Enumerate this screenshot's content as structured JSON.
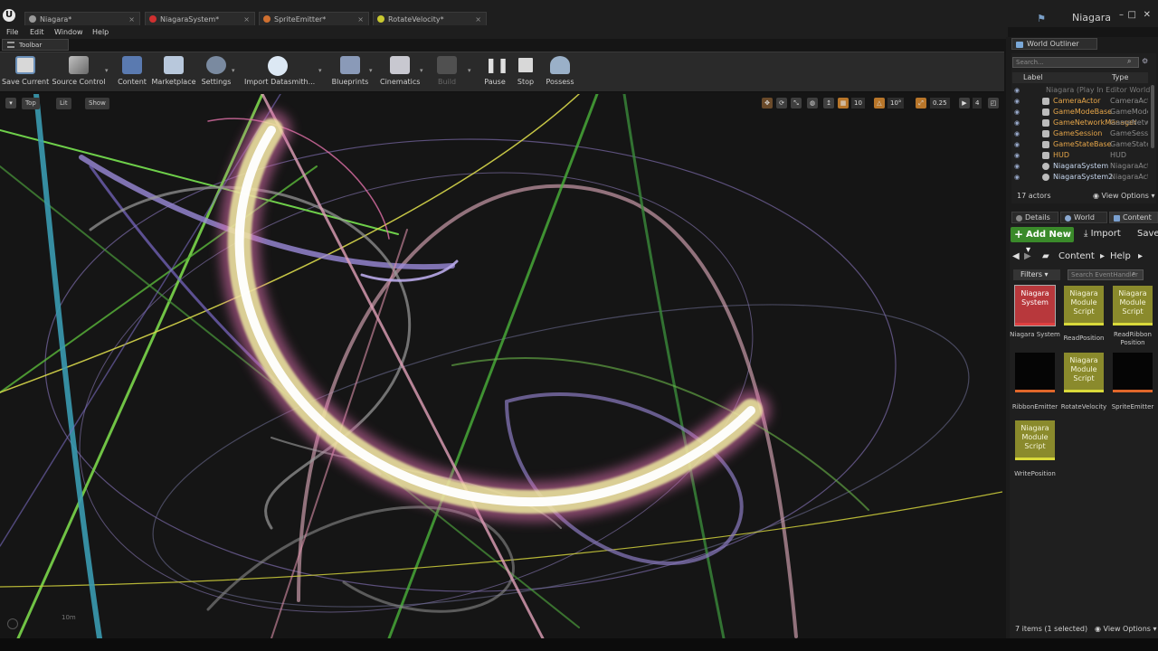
{
  "tabs": [
    {
      "label": "Niagara*"
    },
    {
      "label": "NiagaraSystem*"
    },
    {
      "label": "SpriteEmitter*"
    },
    {
      "label": "RotateVelocity*"
    }
  ],
  "app_name": "Niagara",
  "menu": [
    "File",
    "Edit",
    "Window",
    "Help"
  ],
  "toolbar_tab": "Toolbar",
  "toolbar": [
    {
      "label": "Save Current",
      "icon": "save-icon"
    },
    {
      "label": "Source Control",
      "icon": "source-control-icon"
    },
    {
      "label": "Content",
      "icon": "content-icon"
    },
    {
      "label": "Marketplace",
      "icon": "marketplace-icon"
    },
    {
      "label": "Settings",
      "icon": "settings-icon"
    },
    {
      "label": "Import Datasmith...",
      "icon": "datasmith-icon"
    },
    {
      "label": "Blueprints",
      "icon": "blueprints-icon"
    },
    {
      "label": "Cinematics",
      "icon": "cinematics-icon"
    },
    {
      "label": "Build",
      "icon": "build-icon"
    },
    {
      "label": "Pause",
      "icon": "pause-icon"
    },
    {
      "label": "Stop",
      "icon": "stop-icon"
    },
    {
      "label": "Possess",
      "icon": "possess-icon"
    }
  ],
  "viewport": {
    "view_mode": "Top",
    "lit": "Lit",
    "show": "Show",
    "grid_snap": "10",
    "rotation_snap": "10°",
    "scale_snap": "0.25",
    "camera_speed": "4",
    "scale_label": "10m"
  },
  "outliner": {
    "tab": "World Outliner",
    "search_placeholder": "Search...",
    "col_label": "Label",
    "col_type": "Type",
    "rows": [
      {
        "name": "Niagara (Play In Editor World)",
        "type": ""
      },
      {
        "name": "CameraActor",
        "type": "CameraActor"
      },
      {
        "name": "GameModeBase",
        "type": "GameModeBase"
      },
      {
        "name": "GameNetworkManager",
        "type": "GameNetworkManager"
      },
      {
        "name": "GameSession",
        "type": "GameSession"
      },
      {
        "name": "GameStateBase",
        "type": "GameStateBase"
      },
      {
        "name": "HUD",
        "type": "HUD"
      },
      {
        "name": "NiagaraSystem",
        "type": "NiagaraActor"
      },
      {
        "name": "NiagaraSystem2",
        "type": "NiagaraActor"
      }
    ],
    "actor_count": "17 actors",
    "view_options": "View Options"
  },
  "panel_tabs": [
    {
      "label": "Details"
    },
    {
      "label": "World"
    },
    {
      "label": "Content"
    }
  ],
  "content": {
    "add_new": "Add New",
    "import": "Import",
    "save": "Save",
    "path": [
      "Content",
      "Help"
    ],
    "filters": "Filters",
    "search_placeholder": "Search EventHandler",
    "assets": [
      {
        "thumb": "Niagara System",
        "name": "Niagara System",
        "style": "red"
      },
      {
        "thumb": "Niagara Module Script",
        "name": "ReadPosition",
        "style": "yellow"
      },
      {
        "thumb": "Niagara Module Script",
        "name": "ReadRibbon Position",
        "style": "yellow"
      },
      {
        "thumb": "",
        "name": "RibbonEmitter",
        "style": "dark"
      },
      {
        "thumb": "Niagara Module Script",
        "name": "RotateVelocity",
        "style": "yellow"
      },
      {
        "thumb": "",
        "name": "SpriteEmitter",
        "style": "dark"
      },
      {
        "thumb": "Niagara Module Script",
        "name": "WritePosition",
        "style": "yellow"
      }
    ],
    "items_selected": "7 items (1 selected)",
    "view_options": "View Options"
  }
}
